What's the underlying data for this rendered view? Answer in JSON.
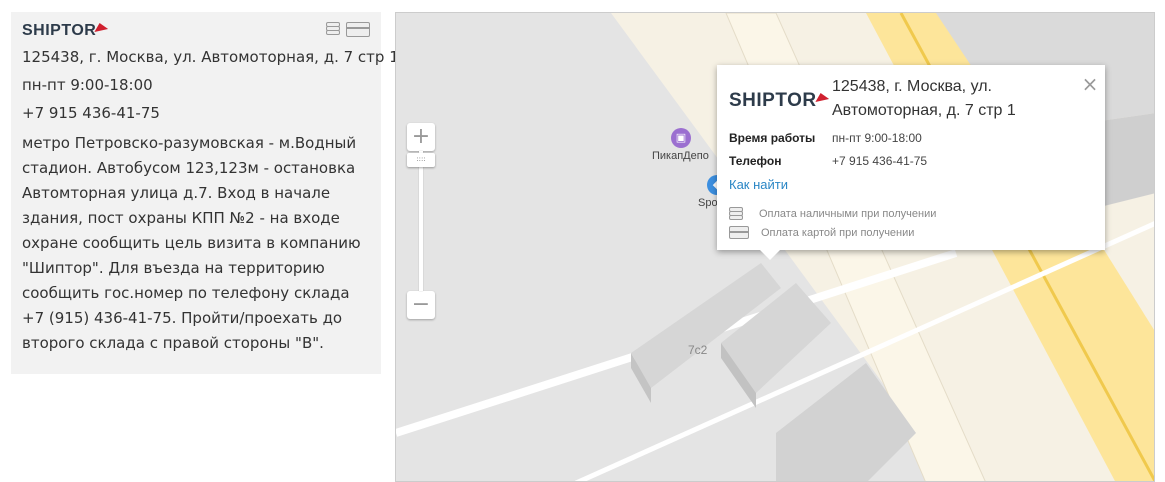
{
  "info": {
    "logo_text": "SHIPTOR",
    "address": "125438, г. Москва, ул. Автомоторная, д. 7 стр 1",
    "hours": "пн-пт 9:00-18:00",
    "phone": "+7 915 436-41-75",
    "directions": "метро Петровско-разумовская - м.Водный стадион. Автобусом 123,123м - остановка Автомторная улица д.7. Вход в начале здания, пост охраны КПП №2 - на входе охране сообщить цель визита в компанию \"Шиптор\". Для въезда на территорию сообщить гос.номер по телефону склада +7 (915) 436-41-75. Пройти/проехать до второго склада с правой стороны \"В\".",
    "payment_icons": [
      "coins-icon",
      "card-icon"
    ]
  },
  "map": {
    "zoom_in": "+",
    "zoom_out": "−",
    "poi": [
      {
        "label": "ПикапДепо",
        "icon": "pickup-icon",
        "color": "#9b6fd0"
      },
      {
        "label": "Spo",
        "icon": "store-icon",
        "color": "#3c8fe0"
      }
    ],
    "building_label": "7с2"
  },
  "balloon": {
    "logo_text": "SHIPTOR",
    "address": "125438, г. Москва, ул. Автомоторная, д. 7 стр 1",
    "hours_label": "Время работы",
    "hours_value": "пн-пт 9:00-18:00",
    "phone_label": "Телефон",
    "phone_value": "+7 915 436-41-75",
    "link": "Как найти",
    "pay_cash": "Оплата наличными при получении",
    "pay_card": "Оплата картой при получении",
    "close": "×"
  },
  "colors": {
    "brand": "#2d3b4a",
    "accent": "#d0202f",
    "link": "#2a86c5",
    "road": "#fbe38c"
  }
}
